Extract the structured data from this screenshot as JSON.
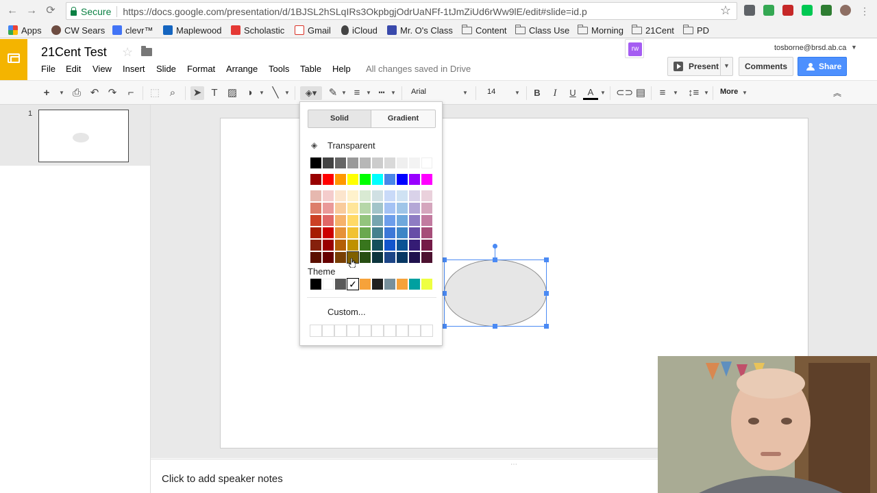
{
  "browser": {
    "secure_label": "Secure",
    "url": "https://docs.google.com/presentation/d/1BJSL2hSLqIRs3OkpbgjOdrUaNFf-1tJmZiUd6rWw9lE/edit#slide=id.p",
    "bookmarks": [
      {
        "label": "Apps",
        "icon": "apps-grid-icon"
      },
      {
        "label": "CW Sears",
        "icon": "cw-sears-icon"
      },
      {
        "label": "clevr™",
        "icon": "clever-icon"
      },
      {
        "label": "Maplewood",
        "icon": "maplewood-icon"
      },
      {
        "label": "Scholastic",
        "icon": "scholastic-icon"
      },
      {
        "label": "Gmail",
        "icon": "gmail-icon"
      },
      {
        "label": "iCloud",
        "icon": "apple-icon"
      },
      {
        "label": "Mr. O's Class",
        "icon": "calendar-icon"
      },
      {
        "label": "Content",
        "icon": "folder-icon"
      },
      {
        "label": "Class Use",
        "icon": "folder-icon"
      },
      {
        "label": "Morning",
        "icon": "folder-icon"
      },
      {
        "label": "21Cent",
        "icon": "folder-icon"
      },
      {
        "label": "PD",
        "icon": "folder-icon"
      }
    ]
  },
  "app": {
    "title": "21Cent Test",
    "menus": [
      "File",
      "Edit",
      "View",
      "Insert",
      "Slide",
      "Format",
      "Arrange",
      "Tools",
      "Table",
      "Help"
    ],
    "save_status": "All changes saved in Drive",
    "user_email": "tosborne@brsd.ab.ca",
    "present_label": "Present",
    "comments_label": "Comments",
    "share_label": "Share",
    "extension_label": "rw"
  },
  "toolbar": {
    "font": "Arial",
    "font_size": "14",
    "more_label": "More",
    "bold": "B",
    "italic": "I",
    "underline": "U",
    "text_color": "A"
  },
  "filmstrip": {
    "slide_number": "1"
  },
  "fill_menu": {
    "tab_solid": "Solid",
    "tab_gradient": "Gradient",
    "transparent_label": "Transparent",
    "theme_label": "Theme",
    "custom_label": "Custom...",
    "theme_check": "✓",
    "gray_row": [
      "#000000",
      "#434343",
      "#666666",
      "#999999",
      "#b7b7b7",
      "#cccccc",
      "#d9d9d9",
      "#efefef",
      "#f3f3f3",
      "#ffffff"
    ],
    "bright_row": [
      "#980000",
      "#ff0000",
      "#ff9900",
      "#ffff00",
      "#00ff00",
      "#00ffff",
      "#4a86e8",
      "#0000ff",
      "#9900ff",
      "#ff00ff"
    ],
    "shade_rows": [
      [
        "#e6b8af",
        "#f4cccc",
        "#fce5cd",
        "#fff2cc",
        "#d9ead3",
        "#d0e0e3",
        "#c9daf8",
        "#cfe2f3",
        "#d9d2e9",
        "#ead1dc"
      ],
      [
        "#dd7e6b",
        "#ea9999",
        "#f9cb9c",
        "#ffe599",
        "#b6d7a8",
        "#a2c4c9",
        "#a4c2f4",
        "#9fc5e8",
        "#b4a7d6",
        "#d5a6bd"
      ],
      [
        "#cc4125",
        "#e06666",
        "#f6b26b",
        "#ffd966",
        "#93c47d",
        "#76a5af",
        "#6d9eeb",
        "#6fa8dc",
        "#8e7cc3",
        "#c27ba0"
      ],
      [
        "#a61c00",
        "#cc0000",
        "#e69138",
        "#f1c232",
        "#6aa84f",
        "#45818e",
        "#3c78d8",
        "#3d85c6",
        "#674ea7",
        "#a64d79"
      ],
      [
        "#85200c",
        "#990000",
        "#b45f06",
        "#bf9000",
        "#38761d",
        "#134f5c",
        "#1155cc",
        "#0b5394",
        "#351c75",
        "#741b47"
      ],
      [
        "#5b0f00",
        "#660000",
        "#783f04",
        "#7f6000",
        "#274e13",
        "#0c343d",
        "#1c4587",
        "#073763",
        "#20124d",
        "#4c1130"
      ]
    ],
    "theme_row": [
      "#000000",
      "#ffffff",
      "#595959",
      "#ffffff",
      "#f6a23a",
      "#212121",
      "#78909c",
      "#f6a23a",
      "#00a0a0",
      "#eeff41"
    ]
  },
  "notes": {
    "placeholder": "Click to add speaker notes"
  },
  "colors": {
    "slides_brand": "#f4b400",
    "share_blue": "#4d90fe",
    "selection_blue": "#4a8af4"
  }
}
